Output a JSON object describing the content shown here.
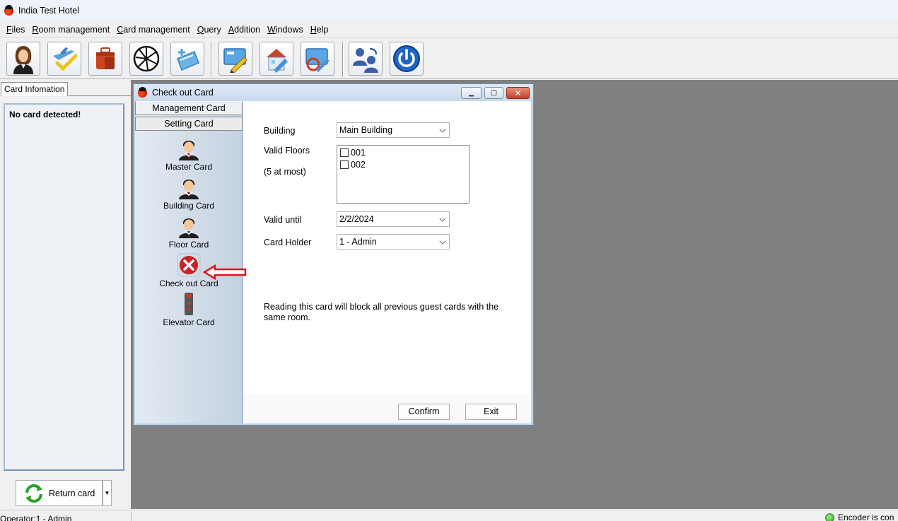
{
  "app": {
    "title": "India Test Hotel"
  },
  "menu": [
    {
      "acc": "F",
      "rest": "iles"
    },
    {
      "acc": "R",
      "rest": "oom management"
    },
    {
      "acc": "C",
      "rest": "ard management"
    },
    {
      "acc": "Q",
      "rest": "uery"
    },
    {
      "acc": "A",
      "rest": "ddition"
    },
    {
      "acc": "W",
      "rest": "indows"
    },
    {
      "acc": "H",
      "rest": "elp"
    }
  ],
  "toolbar": {
    "icons": [
      "user-female-icon",
      "flight-check-icon",
      "luggage-icon",
      "shutter-icon",
      "card-reader-icon",
      "write-card-icon",
      "edit-room-icon",
      "card-refresh-icon",
      "switch-user-icon",
      "power-icon"
    ]
  },
  "left_panel": {
    "tab_label": "Card Infomation",
    "message": "No card detected!",
    "return_button": "Return card",
    "dropdown_glyph": "▼"
  },
  "dialog": {
    "title": "Check out Card",
    "window_buttons": {
      "minimize": "▁",
      "restore": "▢",
      "close": "✕"
    },
    "side_tabs": [
      "Management Card",
      "Setting Card"
    ],
    "side_items": [
      "Master Card",
      "Building Card",
      "Floor Card",
      "Check out Card",
      "Elevator Card"
    ],
    "building_label": "Building",
    "building_value": "Main Building",
    "valid_floors_label": "Valid Floors",
    "valid_floors_hint": "(5 at most)",
    "floors": [
      {
        "label": "001",
        "checked": false
      },
      {
        "label": "002",
        "checked": false
      }
    ],
    "valid_until_label": "Valid until",
    "valid_until_value": "2/2/2024",
    "card_holder_label": "Card Holder",
    "card_holder_value": "1 - Admin",
    "note": "Reading this card will block all previous guest cards with the same room.",
    "confirm": "Confirm",
    "exit": "Exit"
  },
  "status": {
    "operator": "Operator:1 - Admin",
    "encoder": "Encoder is con"
  },
  "colors": {
    "workspace": "#808080",
    "dialog_frame": "#bfd3ea",
    "annotation_arrow": "#e0151b"
  }
}
